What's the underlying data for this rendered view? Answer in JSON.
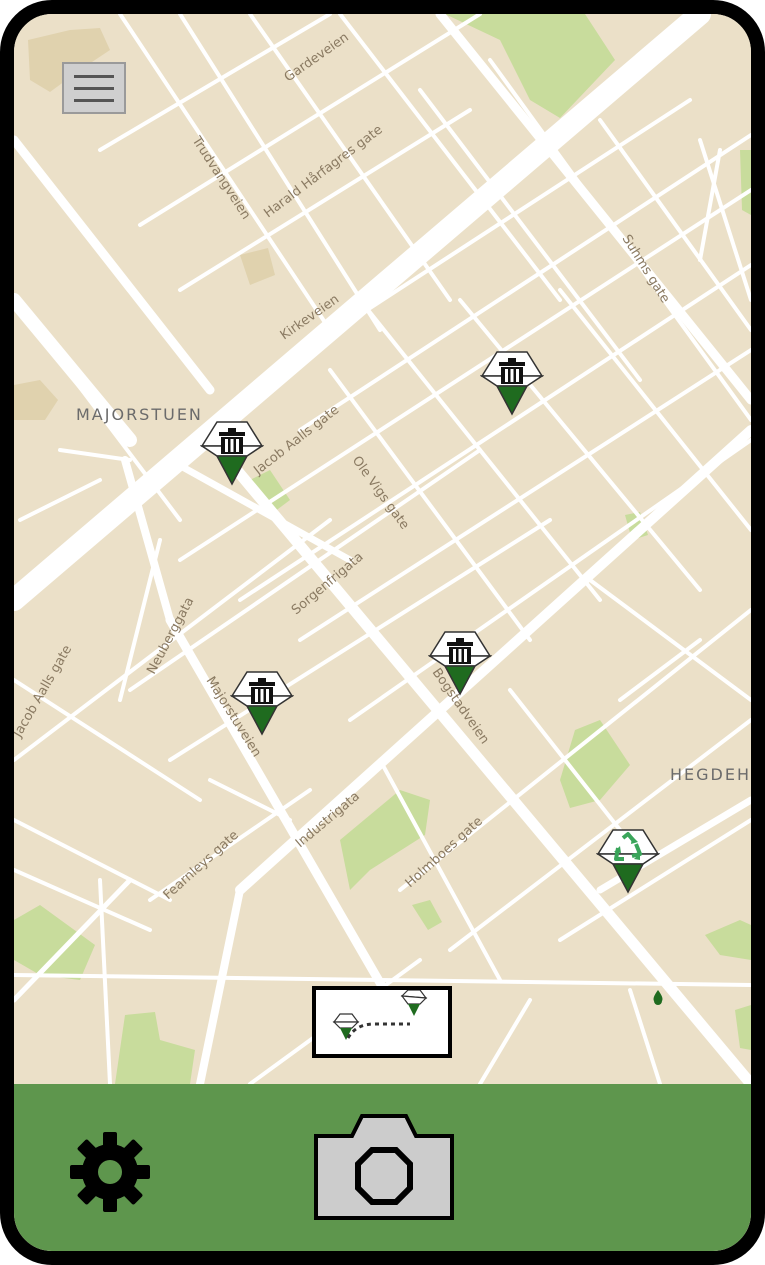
{
  "colors": {
    "map_bg": "#ebe0c8",
    "road": "#ffffff",
    "park": "#c8dc9c",
    "building": "#e0d2ae",
    "bottom_bar": "#5e964d",
    "marker_green": "#1f6b1f",
    "recycle_green": "#3aa55a",
    "label": "#8a7a62"
  },
  "map": {
    "districts": [
      "MAJORSTUEN",
      "HEGDEH"
    ],
    "streets": {
      "gardeveien": "Gardeveien",
      "trudvangveien": "Trudvangveien",
      "harald": "Harald Hårfagres gate",
      "kirkeveien": "Kirkeveien",
      "suhms": "Suhms gate",
      "jacob_aalls": "Jacob Aalls gate",
      "ole_vigs": "Ole Vigs gate",
      "sorgenfrigata": "Sorgenfrigata",
      "neuberggata": "Neuberggata",
      "majorstuveien": "Majorstuveien",
      "bogstadveien": "Bogstadveien",
      "jacob_aalls_2": "Jacob Aalls gate",
      "industrigata": "Industrigata",
      "holmboes": "Holmboes gate",
      "fearnleys": "Fearnleys gate"
    },
    "markers": [
      {
        "type": "trash",
        "icon": "trash-bin-icon"
      },
      {
        "type": "trash",
        "icon": "trash-bin-icon"
      },
      {
        "type": "trash",
        "icon": "trash-bin-icon"
      },
      {
        "type": "trash",
        "icon": "trash-bin-icon"
      },
      {
        "type": "recycle",
        "icon": "recycle-icon"
      }
    ]
  },
  "toolbar": {
    "menu_icon": "hamburger-menu-icon",
    "route_icon": "route-icon",
    "settings_icon": "gear-icon",
    "camera_icon": "camera-icon"
  }
}
